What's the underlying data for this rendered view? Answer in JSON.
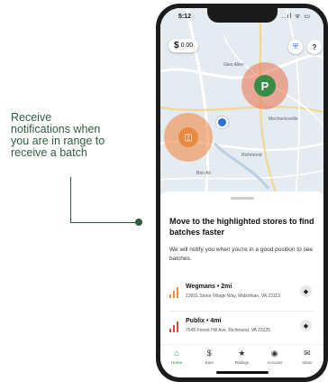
{
  "callout": {
    "line1": "Receive",
    "line2": "notifications when",
    "line3": "you are in range to",
    "line4": "receive a batch"
  },
  "status": {
    "time": "5:12",
    "icons": "..ıl ᯤ ▭"
  },
  "map": {
    "balance": "0.00",
    "balance_symbol": "$",
    "labels": [
      "Glen Allen",
      "Richmond",
      "Mechanicsville",
      "Bon Air"
    ]
  },
  "sheet": {
    "title": "Move to the highlighted stores to find batches faster",
    "subtitle": "We will notify you when you're in a good position to see batches.",
    "stores": [
      {
        "name": "Wegmans • 2mi",
        "address": "12601 Stone Village Way, Midlothian, VA 23113"
      },
      {
        "name": "Publix • 4mi",
        "address": "7045 Forest Hill Ave, Richmond, VA 23225"
      }
    ]
  },
  "tabs": [
    {
      "label": "Home",
      "icon": "home-icon"
    },
    {
      "label": "Earn",
      "icon": "dollar-icon"
    },
    {
      "label": "Ratings",
      "icon": "star-icon"
    },
    {
      "label": "Account",
      "icon": "account-icon"
    },
    {
      "label": "Inbox",
      "icon": "inbox-icon"
    }
  ],
  "colors": {
    "brand_green": "#2f7d3e",
    "signal_orange": "#e8893f",
    "signal_red": "#d84a3c"
  }
}
